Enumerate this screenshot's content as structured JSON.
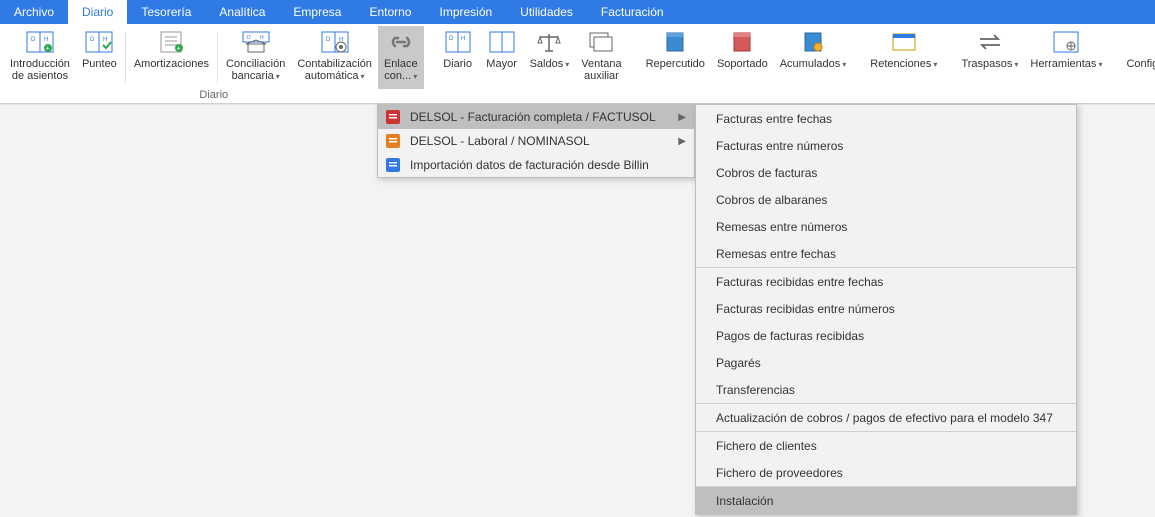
{
  "tabs": [
    "Archivo",
    "Diario",
    "Tesorería",
    "Analítica",
    "Empresa",
    "Entorno",
    "Impresión",
    "Utilidades",
    "Facturación"
  ],
  "active_tab": 1,
  "ribbon_groups": {
    "diario_label": "Diario"
  },
  "ribbon": {
    "introduccion": "Introducción\nde asientos",
    "punteo": "Punteo",
    "amortizaciones": "Amortizaciones",
    "conciliacion": "Conciliación\nbancaria",
    "contabilizacion": "Contabilización\nautomática",
    "enlace": "Enlace\ncon...",
    "diario": "Diario",
    "mayor": "Mayor",
    "saldos": "Saldos",
    "ventana": "Ventana\nauxiliar",
    "repercutido": "Repercutido",
    "soportado": "Soportado",
    "acumulados": "Acumulados",
    "retenciones": "Retenciones",
    "traspasos": "Traspasos",
    "herramientas": "Herramientas",
    "configuraciones": "Configuraciones"
  },
  "menu1": [
    {
      "label": "DELSOL - Facturación completa / FACTUSOL",
      "submenu": true,
      "hover": true,
      "iconcolor": "#c33"
    },
    {
      "label": "DELSOL - Laboral / NOMINASOL",
      "submenu": true,
      "hover": false,
      "iconcolor": "#e67e22"
    },
    {
      "label": "Importación datos de facturación desde Billin",
      "submenu": false,
      "hover": false,
      "iconcolor": "#2f7ae5"
    }
  ],
  "menu2_groups": [
    [
      "Facturas entre fechas",
      "Facturas entre números",
      "Cobros de facturas",
      "Cobros de albaranes",
      "Remesas entre números",
      "Remesas entre fechas"
    ],
    [
      "Facturas recibidas entre fechas",
      "Facturas recibidas entre números",
      "Pagos de facturas recibidas",
      "Pagarés",
      "Transferencias"
    ],
    [
      "Actualización de cobros / pagos de efectivo para el modelo 347"
    ],
    [
      "Fichero de clientes",
      "Fichero de proveedores"
    ],
    [
      "Instalación"
    ]
  ],
  "menu2_hovered": "Instalación"
}
